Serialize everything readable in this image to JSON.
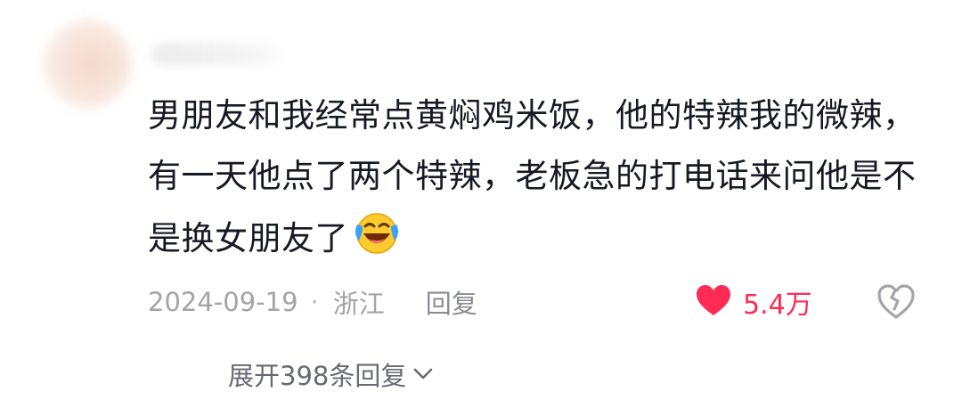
{
  "comment": {
    "text": "男朋友和我经常点黄焖鸡米饭，他的特辣我的微辣，有一天他点了两个特辣，老板急的打电话来问他是不是换女朋友了",
    "emoji": "laughing-tears-emoji",
    "date": "2024-09-19",
    "separator": "·",
    "location": "浙江",
    "reply_label": "回复",
    "like_count": "5.4万",
    "expand_label": "展开398条回复"
  },
  "colors": {
    "like_red": "#fe2c55",
    "meta_gray": "#a3a4a8",
    "text_dark": "#161823"
  }
}
